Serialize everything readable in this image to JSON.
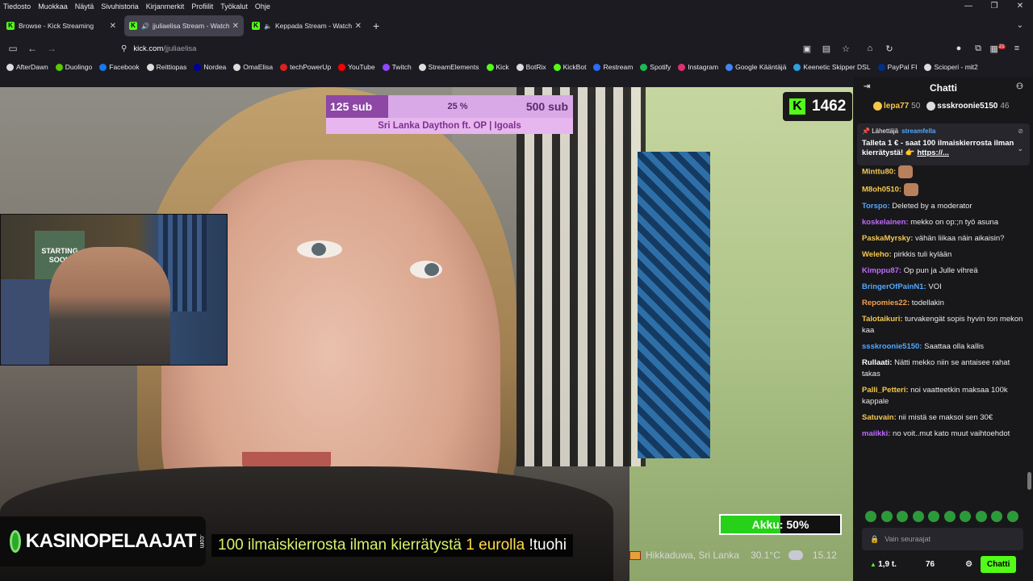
{
  "menu": [
    "Tiedosto",
    "Muokkaa",
    "Näytä",
    "Sivuhistoria",
    "Kirjanmerkit",
    "Profiilit",
    "Työkalut",
    "Ohje"
  ],
  "tabs": [
    {
      "label": "Browse - Kick Streaming",
      "active": false
    },
    {
      "label": "jjuliaelisa Stream - Watch Li",
      "active": true
    },
    {
      "label": "Keppada Stream - Watch Li",
      "active": false
    }
  ],
  "url": {
    "host": "kick.com",
    "path": "/jjuliaelisa"
  },
  "extensions_badge": "21",
  "bookmarks": [
    {
      "label": "AfterDawn",
      "color": "#ddd"
    },
    {
      "label": "Duolingo",
      "color": "#58cc02"
    },
    {
      "label": "Facebook",
      "color": "#1877f2"
    },
    {
      "label": "Reittiopas",
      "color": "#ddd"
    },
    {
      "label": "Nordea",
      "color": "#0000a0"
    },
    {
      "label": "OmaElisa",
      "color": "#ddd"
    },
    {
      "label": "techPowerUp",
      "color": "#e02020"
    },
    {
      "label": "YouTube",
      "color": "#ff0000"
    },
    {
      "label": "Twitch",
      "color": "#9146ff"
    },
    {
      "label": "StreamElements",
      "color": "#ddd"
    },
    {
      "label": "Kick",
      "color": "#53fc18"
    },
    {
      "label": "BotRix",
      "color": "#ddd"
    },
    {
      "label": "KickBot",
      "color": "#53fc18"
    },
    {
      "label": "Restream",
      "color": "#2b6cff"
    },
    {
      "label": "Spotify",
      "color": "#1db954"
    },
    {
      "label": "Instagram",
      "color": "#e1306c"
    },
    {
      "label": "Google Kääntäjä",
      "color": "#4285f4"
    },
    {
      "label": "Keenetic Skipper DSL",
      "color": "#2aa3e0"
    },
    {
      "label": "PayPal FI",
      "color": "#003087"
    },
    {
      "label": "Scioperi - mit2",
      "color": "#ddd"
    }
  ],
  "overlay": {
    "sub_goal": {
      "from": "125 sub",
      "percent": "25 %",
      "to": "500 sub",
      "progress": 0.25,
      "title": "Sri Lanka Daython ft. OP | Igoals"
    },
    "viewer_count": "1462",
    "battery": {
      "label": "Akku: 50%",
      "level": 0.5
    },
    "brand": "KASINOPELAAJAT",
    "brand_tld": ".com",
    "promo": {
      "p1": "100 ilmaiskierrosta ilman kierrätystä",
      "p2": "1 eurolla",
      "p3": "!tuohi"
    },
    "location": "Hikkaduwa, Sri Lanka",
    "temperature": "30.1°C",
    "time": "15.12",
    "pip_poster": "STARTING SOON"
  },
  "chat": {
    "title": "Chatti",
    "gifters": [
      {
        "name": "lepa77",
        "count": "50"
      },
      {
        "name": "ssskroonie5150",
        "count": "46"
      }
    ],
    "pinned": {
      "label": "Lähettäjä",
      "by": "streamfella",
      "message": "Talleta 1 € - saat 100 ilmaiskierrosta ilman kierrätystä! 👉 ",
      "link": "https://..."
    },
    "messages": [
      {
        "user": "Minttu80:",
        "color": "#f5c84c",
        "text": ""
      },
      {
        "user": "M8oh0510:",
        "color": "#f5c84c",
        "text": ""
      },
      {
        "user": "Torspo:",
        "color": "#53a8fc",
        "text": "Deleted by a moderator"
      },
      {
        "user": "koskelainen:",
        "color": "#c06bff",
        "text": "mekko on op:;n työ asuna"
      },
      {
        "user": "PaskaMyrsky:",
        "color": "#f5c84c",
        "text": "vähän liikaa näin aikaisin?"
      },
      {
        "user": "Weleho:",
        "color": "#f5c84c",
        "text": "pirkkis tuli kylään"
      },
      {
        "user": "Kimppu87:",
        "color": "#c06bff",
        "text": "Op pun ja Julle vihreä"
      },
      {
        "user": "BringerOfPainN1:",
        "color": "#53a8fc",
        "text": "VOI"
      },
      {
        "user": "Repomies22:",
        "color": "#f5a04c",
        "text": "todellakin"
      },
      {
        "user": "Talotaikuri:",
        "color": "#f5c84c",
        "text": "turvakengät sopis hyvin ton mekon kaa"
      },
      {
        "user": "ssskroonie5150:",
        "color": "#53a8fc",
        "text": "Saattaa olla kallis"
      },
      {
        "user": "Rullaati:",
        "color": "#ffffff",
        "text": "Nätti mekko niin se antaisee rahat takas"
      },
      {
        "user": "Palli_Petteri:",
        "color": "#f5c84c",
        "text": "noi vaatteetkin maksaa 100k kappale"
      },
      {
        "user": "Satuvain:",
        "color": "#f5c84c",
        "text": "nii mistä se maksoi sen 30€"
      },
      {
        "user": "maiikki:",
        "color": "#c06bff",
        "text": "no voit..mut kato muut vaihtoehdot"
      }
    ],
    "input_placeholder": "Vain seuraajat",
    "kicks": "1,9 t.",
    "points": "76",
    "send_label": "Chatti"
  }
}
